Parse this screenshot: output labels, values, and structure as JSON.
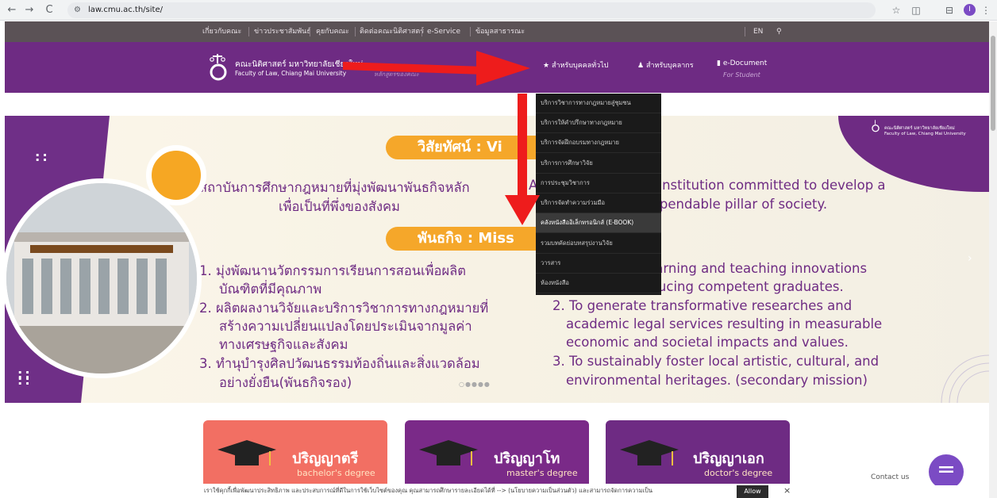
{
  "browser": {
    "url": "law.cmu.ac.th/site/",
    "back_icon": "←",
    "forward_icon": "→",
    "reload_icon": "C",
    "profile_initial": "I"
  },
  "topnav": {
    "items": [
      "เกี่ยวกับคณะ",
      "ข่าวประชาสัมพันธ์",
      "คุยกับคณะ",
      "ติดต่อคณะนิติศาสตร์",
      "e-Service",
      "ข้อมูลสาธารณะ"
    ],
    "lang": "EN"
  },
  "header": {
    "logo_th": "คณะนิติศาสตร์ มหาวิทยาลัยเชียงใหม่",
    "logo_en": "Faculty of Law, Chiang Mai University",
    "logo_sub": "หลักสูตรของคณะ",
    "logo_small": "Faculty of Law",
    "nav": [
      {
        "label": "สำหรับบุคคลทั่วไป",
        "icon": "star-icon"
      },
      {
        "label": "สำหรับบุคลากร",
        "icon": "users-icon"
      },
      {
        "label": "e-Document",
        "icon": "file-icon"
      }
    ],
    "nav_sub": "For Student"
  },
  "dropdown": {
    "items": [
      "บริการวิชาการทางกฎหมายสู่ชุมชน",
      "บริการให้คำปรึกษาทางกฎหมาย",
      "บริการจัดฝึกอบรมทางกฎหมาย",
      "บริการการศึกษาวิจัย",
      "การประชุมวิชาการ",
      "บริการจัดทำความร่วมมือ",
      "คลังหนังสืออิเล็กทรอนิกส์ (E-BOOK)",
      "รวมบทคัดย่อบทสรุปงานวิจัย",
      "วารสาร",
      "ห้องหนังสือ"
    ],
    "active_index": 6
  },
  "hero": {
    "vision_badge": "วิสัยทัศน์ : Vi",
    "vision_th_1": "สถาบันการศึกษากฎหมายที่มุ่งพัฒนาพันธกิจหลัก",
    "vision_th_2": "เพื่อเป็นที่พึ่งของสังคม",
    "vision_en_1": "A legal educational institution committed to develop a",
    "vision_en_2": "mission to be a dependable pillar of society.",
    "mission_badge": "พันธกิจ : Miss",
    "mission_th": [
      "1. มุ่งพัฒนานวัตกรรมการเรียนการสอนเพื่อผลิต",
      "บัณฑิตที่มีคุณภาพ",
      "2. ผลิตผลงานวิจัยและบริการวิชาการทางกฎหมายที่",
      "สร้างความเปลี่ยนแปลงโดยประเมินจากมูลค่า",
      "ทางเศรษฐกิจและสังคม",
      "3. ทำนุบำรุงศิลปวัฒนธรรมท้องถิ่นและสิ่งแวดล้อม",
      "อย่างยั่งยืน(พันธกิจรอง)"
    ],
    "mission_en": [
      "1. To develop learning and teaching innovations",
      "aimed at producing competent graduates.",
      "2. To generate transformative researches and",
      "academic legal services resulting in measurable",
      "economic and societal impacts and values.",
      "3. To sustainably foster local artistic, cultural, and",
      "environmental heritages. (secondary mission)"
    ],
    "badge_th": "คณะนิติศาสตร์ มหาวิทยาลัยเชียงใหม่",
    "badge_en": "Faculty of Law, Chiang Mai University",
    "slide_dots": "○●●●●"
  },
  "cards": [
    {
      "title": "ปริญญาตรี",
      "subtitle": "bachelor's degree",
      "color": "#f26f63"
    },
    {
      "title": "ปริญญาโท",
      "subtitle": "master's degree",
      "color": "#7a2a88"
    },
    {
      "title": "ปริญญาเอก",
      "subtitle": "doctor's degree",
      "color": "#6e2b83"
    }
  ],
  "cookie": {
    "text": "เราใช้คุกกี้เพื่อพัฒนาประสิทธิภาพ และประสบการณ์ที่ดีในการใช้เว็บไซต์ของคุณ คุณสามารถศึกษารายละเอียดได้ที่ --> (นโยบายความเป็นส่วนตัว) และสามารถจัดการความเป็น",
    "allow": "Allow",
    "close": "×"
  },
  "contact": {
    "label": "Contact us"
  },
  "colors": {
    "purple": "#6e2b83",
    "orange": "#f5a72a",
    "arrow_red": "#ee1c1c"
  }
}
